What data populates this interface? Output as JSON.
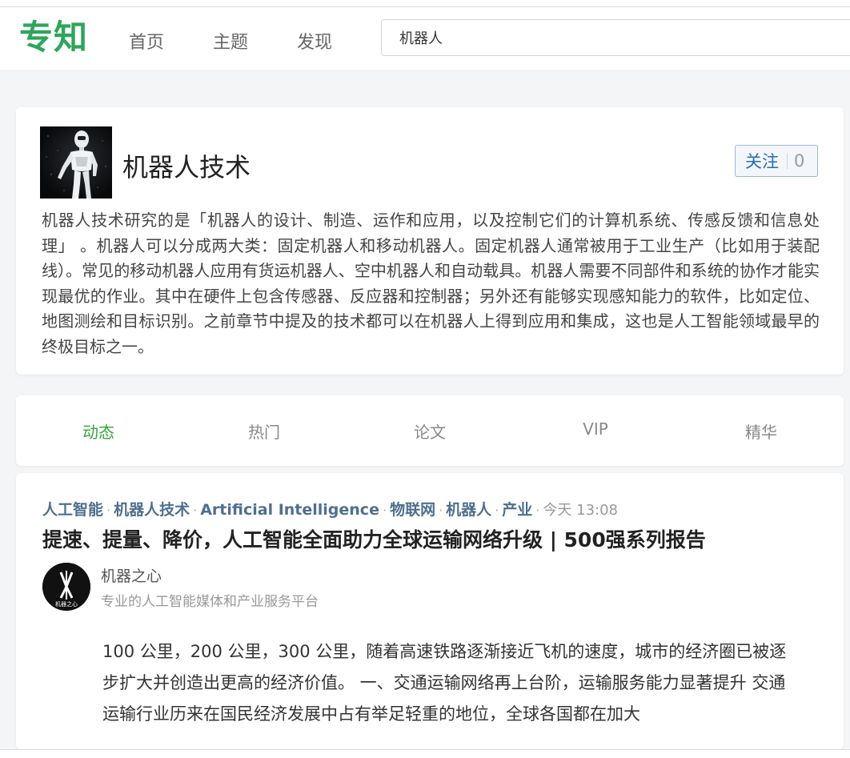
{
  "header": {
    "logo": "专知",
    "nav": [
      "首页",
      "主题",
      "发现"
    ],
    "search_value": "机器人"
  },
  "topic": {
    "title": "机器人技术",
    "follow_label": "关注",
    "follow_count": "0",
    "description": "机器人技术研究的是「机器人的设计、制造、运作和应用，以及控制它们的计算机系统、传感反馈和信息处理」 。机器人可以分成两大类：固定机器人和移动机器人。固定机器人通常被用于工业生产（比如用于装配线）。常见的移动机器人应用有货运机器人、空中机器人和自动载具。机器人需要不同部件和系统的协作才能实现最优的作业。其中在硬件上包含传感器、反应器和控制器；另外还有能够实现感知能力的软件，比如定位、地图测绘和目标识别。之前章节中提及的技术都可以在机器人上得到应用和集成，这也是人工智能领域最早的终极目标之一。"
  },
  "tabs": [
    "动态",
    "热门",
    "论文",
    "VIP",
    "精华"
  ],
  "article": {
    "tags": [
      "人工智能",
      "机器人技术",
      "Artificial Intelligence",
      "物联网",
      "机器人",
      "产业"
    ],
    "time": "今天 13:08",
    "title": "提速、提量、降价，人工智能全面助力全球运输网络升级 | 500强系列报告",
    "author_name": "机器之心",
    "author_bio": "专业的人工智能媒体和产业服务平台",
    "author_logo_text": "机器之心",
    "excerpt": "100 公里，200 公里，300 公里，随着高速铁路逐渐接近飞机的速度，城市的经济圈已被逐步扩大并创造出更高的经济价值。 一、交通运输网络再上台阶，运输服务能力显著提升 交通运输行业历来在国民经济发展中占有举足轻重的地位，全球各国都在加大"
  },
  "colors": {
    "brand": "#2ea55b",
    "active_tab": "#35a43c",
    "tag": "#4f6f8f",
    "follow": "#2b6cb0"
  }
}
